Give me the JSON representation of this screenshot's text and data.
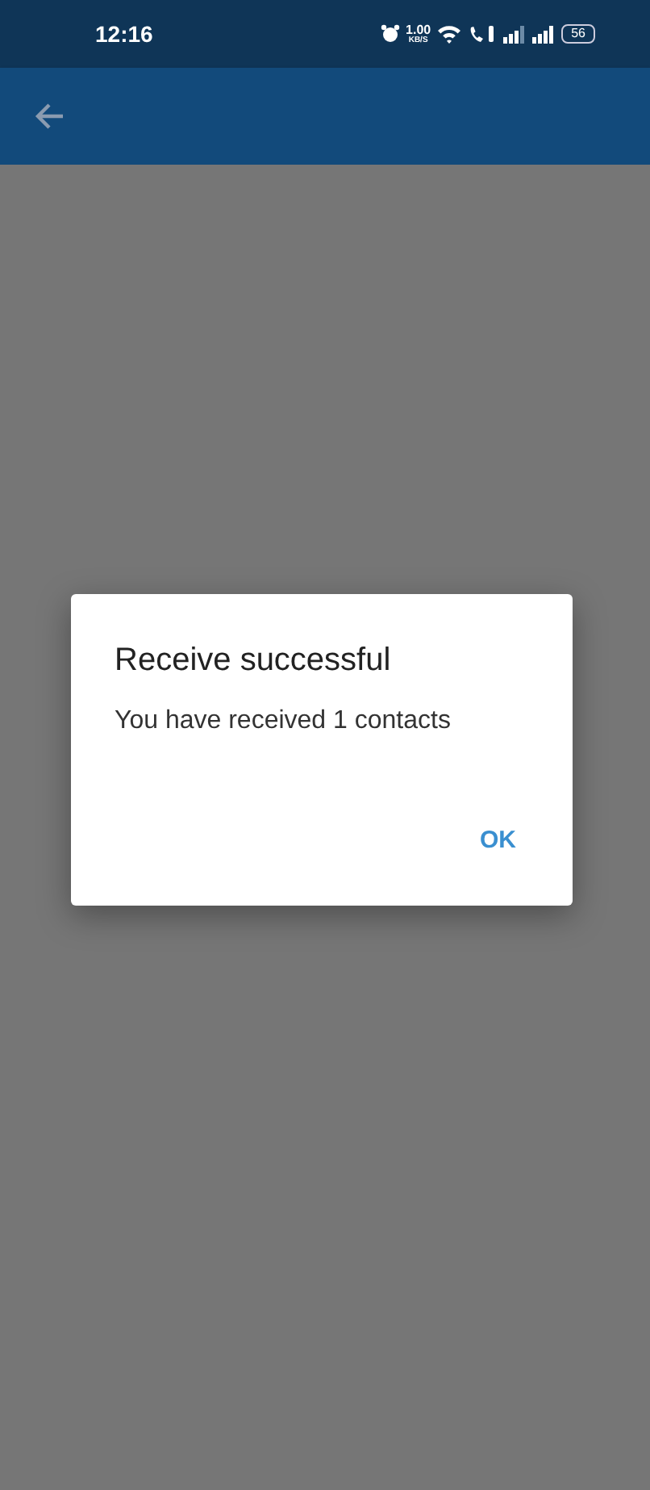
{
  "status_bar": {
    "time": "12:16",
    "speed_value": "1.00",
    "speed_unit": "KB/S",
    "battery": "56"
  },
  "dialog": {
    "title": "Receive successful",
    "message": "You have received 1 contacts",
    "buttons": [
      "OK"
    ]
  }
}
